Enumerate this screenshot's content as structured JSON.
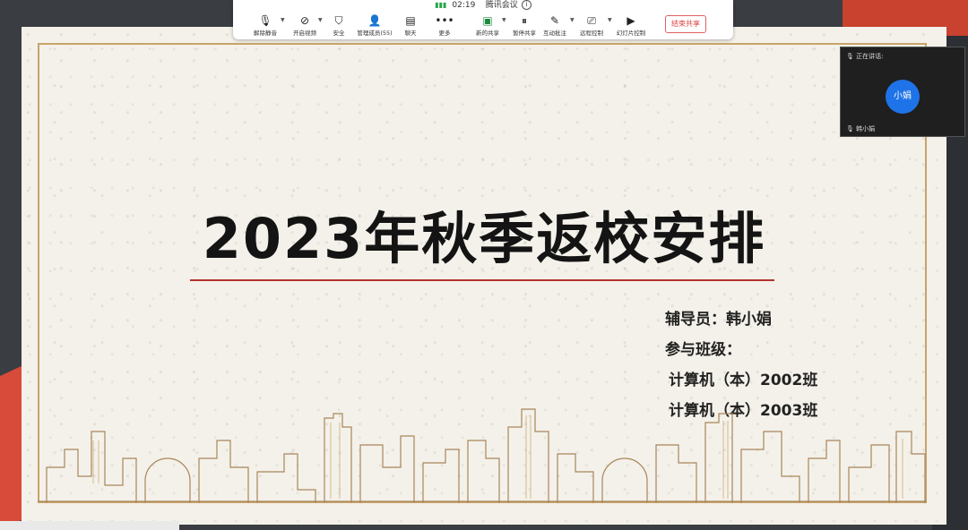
{
  "toolbar": {
    "time": "02:19",
    "app_name": "腾讯会议",
    "items": [
      {
        "label": "解除静音",
        "icon": "mic-muted-icon"
      },
      {
        "label": "开启视频",
        "icon": "video-off-icon"
      },
      {
        "label": "安全",
        "icon": "shield-icon"
      },
      {
        "label": "管理成员(55)",
        "icon": "members-icon"
      },
      {
        "label": "聊天",
        "icon": "chat-icon"
      },
      {
        "label": "更多",
        "icon": "more-icon"
      },
      {
        "label": "新的共享",
        "icon": "share-icon"
      },
      {
        "label": "暂停共享",
        "icon": "pause-icon"
      },
      {
        "label": "互动批注",
        "icon": "annotate-icon"
      },
      {
        "label": "远程控制",
        "icon": "remote-control-icon"
      },
      {
        "label": "幻灯片控制",
        "icon": "slideshow-icon"
      }
    ],
    "end_share": "结束共享"
  },
  "slide": {
    "title": "2023年秋季返校安排",
    "counselor": "辅导员：韩小娟",
    "classes_label": "参与班级：",
    "class_1": "计算机（本）2002班",
    "class_2": "计算机（本）2003班"
  },
  "participant": {
    "status": "正在讲话:",
    "avatar_text": "小娟",
    "name": "韩小娟"
  },
  "colors": {
    "accent_red": "#b5322b",
    "frame_gold": "#c8a46a",
    "avatar_blue": "#1e73e8"
  }
}
